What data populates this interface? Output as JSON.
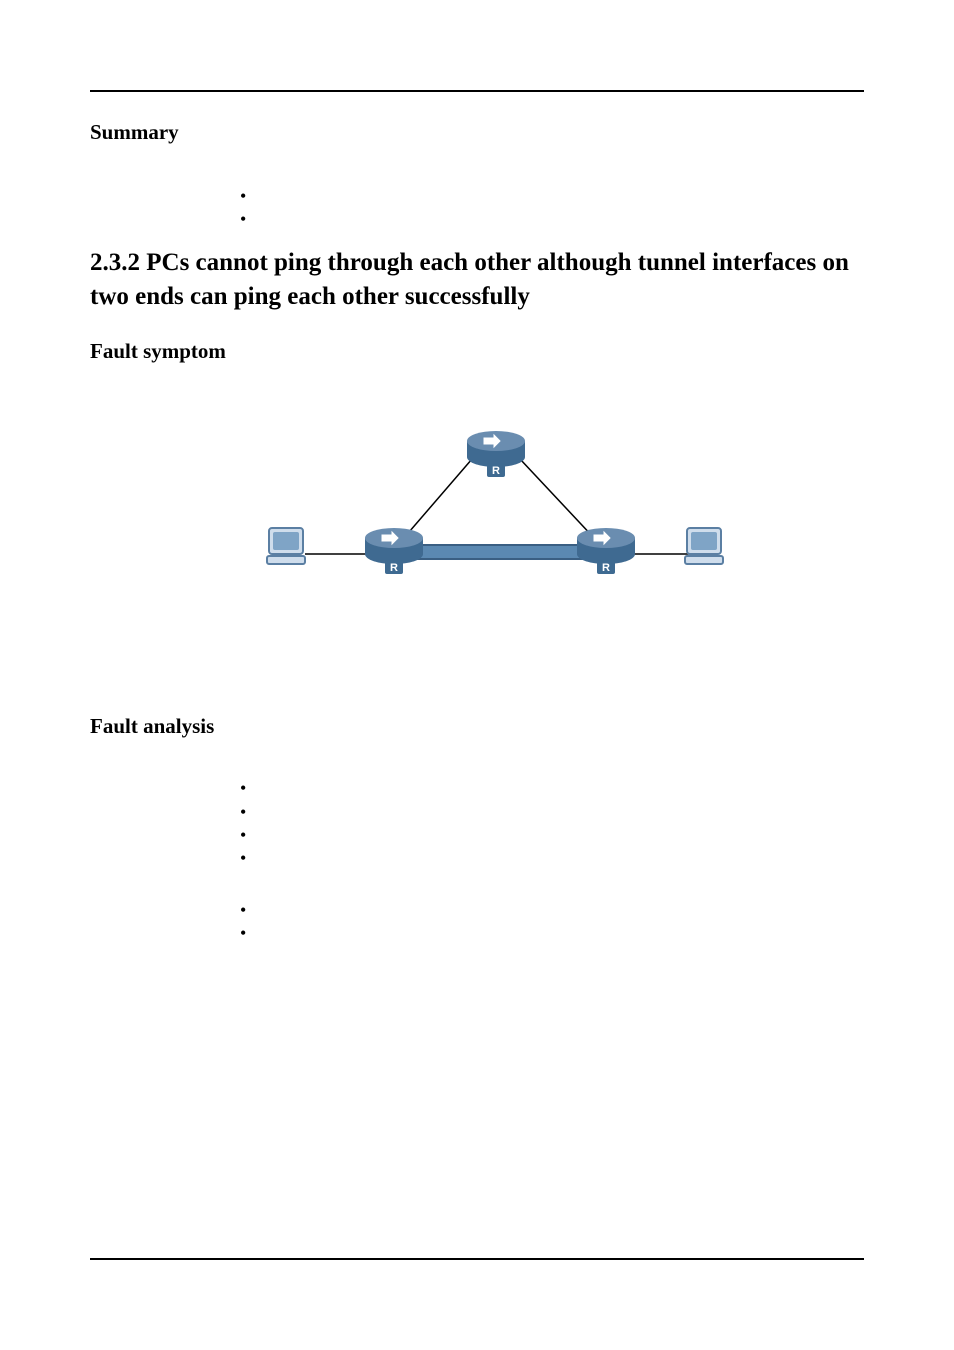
{
  "headings": {
    "summary": "Summary",
    "section_number": "2.3.2",
    "section_title": "PCs cannot ping through each other although tunnel interfaces on two ends can ping each other successfully",
    "fault_symptom": "Fault symptom",
    "fault_analysis": "Fault analysis"
  },
  "bullets": {
    "summary_items": [
      "",
      ""
    ],
    "analysis_group1": [
      "",
      "",
      "",
      ""
    ],
    "analysis_group2": [
      "",
      ""
    ]
  },
  "diagram": {
    "nodes": {
      "top_router": "R",
      "left_router": "R",
      "right_router": "R",
      "left_pc": "PC",
      "right_pc": "PC"
    },
    "description": "Two PCs each connected to a router; both routers connect via a top router and also via a direct tunnel between them."
  }
}
